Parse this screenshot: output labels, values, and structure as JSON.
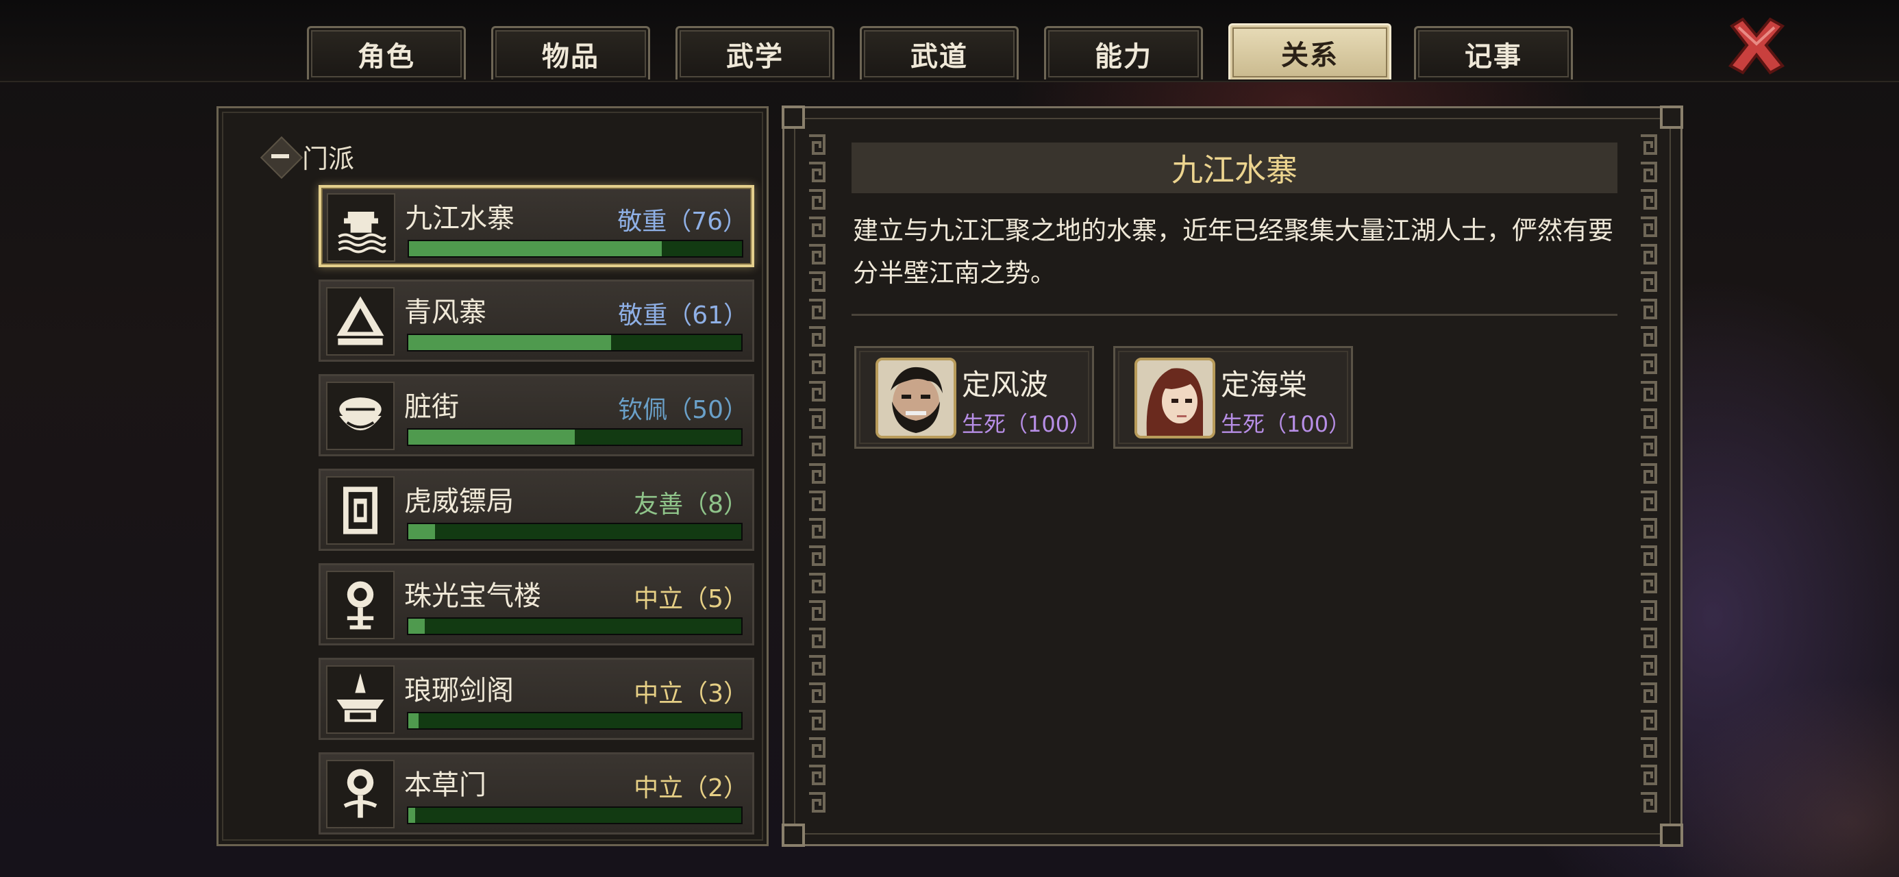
{
  "tabs": [
    {
      "label": "角色",
      "active": false
    },
    {
      "label": "物品",
      "active": false
    },
    {
      "label": "武学",
      "active": false
    },
    {
      "label": "武道",
      "active": false
    },
    {
      "label": "能力",
      "active": false
    },
    {
      "label": "关系",
      "active": true
    },
    {
      "label": "记事",
      "active": false
    }
  ],
  "close_icon": "close-x-icon",
  "category": {
    "label": "门派",
    "toggle_icon": "collapse-minus-icon"
  },
  "factions": [
    {
      "name": "九江水寨",
      "status": "敬重（76）",
      "level": 76,
      "max": 100,
      "status_color": "#8fb0e6",
      "icon": "water-fortress-icon",
      "selected": true
    },
    {
      "name": "青风寨",
      "status": "敬重（61）",
      "level": 61,
      "max": 100,
      "status_color": "#8fb0e6",
      "icon": "mountain-tent-icon",
      "selected": false
    },
    {
      "name": "脏街",
      "status": "钦佩（50）",
      "level": 50,
      "max": 100,
      "status_color": "#6aa0c8",
      "icon": "beggar-bowl-icon",
      "selected": false
    },
    {
      "name": "虎威镖局",
      "status": "友善（8）",
      "level": 8,
      "max": 100,
      "status_color": "#8fc48a",
      "icon": "escort-banner-icon",
      "selected": false
    },
    {
      "name": "珠光宝气楼",
      "status": "中立（5）",
      "level": 5,
      "max": 100,
      "status_color": "#e6cf85",
      "icon": "treasure-tower-icon",
      "selected": false
    },
    {
      "name": "琅琊剑阁",
      "status": "中立（3）",
      "level": 3,
      "max": 100,
      "status_color": "#e6cf85",
      "icon": "sword-pavilion-icon",
      "selected": false
    },
    {
      "name": "本草门",
      "status": "中立（2）",
      "level": 2,
      "max": 100,
      "status_color": "#e6cf85",
      "icon": "herb-medicine-icon",
      "selected": false
    }
  ],
  "detail": {
    "title": "九江水寨",
    "description": "建立与九江汇聚之地的水寨，近年已经聚集大量江湖人士，俨然有要分半壁江南之势。",
    "members": [
      {
        "name": "定风波",
        "relation": "生死（100）",
        "portrait": "bearded-man-portrait"
      },
      {
        "name": "定海棠",
        "relation": "生死（100）",
        "portrait": "red-haired-woman-portrait"
      }
    ]
  },
  "colors": {
    "accent_gold": "#e4cf8c",
    "bar_fill": "#4f9a4e",
    "bar_track": "#123a12",
    "relation_purple": "#b78ee6"
  }
}
